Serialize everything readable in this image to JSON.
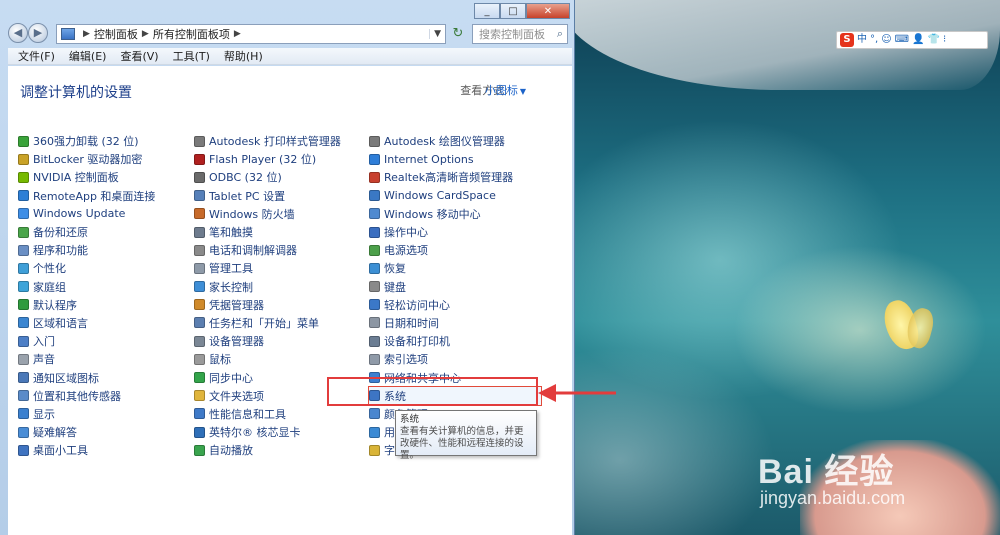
{
  "window": {
    "breadcrumb": [
      "控制面板",
      "所有控制面板项"
    ],
    "search_placeholder": "搜索控制面板",
    "menu": [
      "文件(F)",
      "编辑(E)",
      "查看(V)",
      "工具(T)",
      "帮助(H)"
    ],
    "page_title": "调整计算机的设置",
    "view_by_label": "查看方式:",
    "view_by_value": "小图标"
  },
  "columns": [
    [
      {
        "label": "360强力卸载 (32 位)",
        "color": "#3aa33a"
      },
      {
        "label": "BitLocker 驱动器加密",
        "color": "#c9a227"
      },
      {
        "label": "NVIDIA 控制面板",
        "color": "#76b900"
      },
      {
        "label": "RemoteApp 和桌面连接",
        "color": "#2d7fd6"
      },
      {
        "label": "Windows Update",
        "color": "#3e8ee6"
      },
      {
        "label": "备份和还原",
        "color": "#4aa54a"
      },
      {
        "label": "程序和功能",
        "color": "#6a8fc4"
      },
      {
        "label": "个性化",
        "color": "#3f9fd8"
      },
      {
        "label": "家庭组",
        "color": "#3da4d9"
      },
      {
        "label": "默认程序",
        "color": "#2f9b3f"
      },
      {
        "label": "区域和语言",
        "color": "#3b86d1"
      },
      {
        "label": "入门",
        "color": "#4d7fc6"
      },
      {
        "label": "声音",
        "color": "#9aa2ac"
      },
      {
        "label": "通知区域图标",
        "color": "#4a78b8"
      },
      {
        "label": "位置和其他传感器",
        "color": "#5a8bc9"
      },
      {
        "label": "显示",
        "color": "#3b80cf"
      },
      {
        "label": "疑难解答",
        "color": "#4a8dd6"
      },
      {
        "label": "桌面小工具",
        "color": "#3f73c0"
      }
    ],
    [
      {
        "label": "Autodesk 打印样式管理器",
        "color": "#7a7a7a"
      },
      {
        "label": "Flash Player (32 位)",
        "color": "#b0201f"
      },
      {
        "label": "ODBC (32 位)",
        "color": "#6a6a6a"
      },
      {
        "label": "Tablet PC 设置",
        "color": "#5680b9"
      },
      {
        "label": "Windows 防火墙",
        "color": "#c76a2a"
      },
      {
        "label": "笔和触摸",
        "color": "#6e7b8d"
      },
      {
        "label": "电话和调制解调器",
        "color": "#8a8a8a"
      },
      {
        "label": "管理工具",
        "color": "#8e9aa8"
      },
      {
        "label": "家长控制",
        "color": "#3e8ed6"
      },
      {
        "label": "凭据管理器",
        "color": "#d08a2a"
      },
      {
        "label": "任务栏和「开始」菜单",
        "color": "#5c7fb0"
      },
      {
        "label": "设备管理器",
        "color": "#7b8795"
      },
      {
        "label": "鼠标",
        "color": "#9a9a9a"
      },
      {
        "label": "同步中心",
        "color": "#33a44a"
      },
      {
        "label": "文件夹选项",
        "color": "#e0b53c"
      },
      {
        "label": "性能信息和工具",
        "color": "#3f7ac8"
      },
      {
        "label": "英特尔® 核芯显卡",
        "color": "#2f6fb8"
      },
      {
        "label": "自动播放",
        "color": "#3aa44e"
      }
    ],
    [
      {
        "label": "Autodesk 绘图仪管理器",
        "color": "#7a7a7a"
      },
      {
        "label": "Internet Options",
        "color": "#2f7ed8"
      },
      {
        "label": "Realtek高清晰音频管理器",
        "color": "#c8402e"
      },
      {
        "label": "Windows CardSpace",
        "color": "#3a78c4"
      },
      {
        "label": "Windows 移动中心",
        "color": "#4f8ad0"
      },
      {
        "label": "操作中心",
        "color": "#3a6ec0"
      },
      {
        "label": "电源选项",
        "color": "#4ca04a"
      },
      {
        "label": "恢复",
        "color": "#3c8fd4"
      },
      {
        "label": "键盘",
        "color": "#8a8a8a"
      },
      {
        "label": "轻松访问中心",
        "color": "#3b78c8"
      },
      {
        "label": "日期和时间",
        "color": "#8c96a3"
      },
      {
        "label": "设备和打印机",
        "color": "#6b7d93"
      },
      {
        "label": "索引选项",
        "color": "#8f9aa8"
      },
      {
        "label": "网络和共享中心",
        "color": "#3d7fd0"
      },
      {
        "label": "系统",
        "color": "#3d75c4",
        "selected": true
      },
      {
        "label": "颜色管理",
        "color": "#4a86cf"
      },
      {
        "label": "用户帐户",
        "color": "#3b8ad4"
      },
      {
        "label": "字体",
        "color": "#d9b437"
      }
    ]
  ],
  "tooltip": {
    "title": "系统",
    "text": "查看有关计算机的信息，并更改硬件、性能和远程连接的设置。"
  },
  "ime": {
    "brand": "S",
    "labels": [
      "中",
      "°,",
      "☺",
      "⌨",
      "👤",
      "👕",
      "⁝"
    ]
  },
  "watermark": {
    "line1": "Bai 经验",
    "line2": "jingyan.baidu.com"
  },
  "colors": {
    "annotation": "#e23c3c",
    "link": "#1f3f7e",
    "title": "#1d3f8a"
  }
}
